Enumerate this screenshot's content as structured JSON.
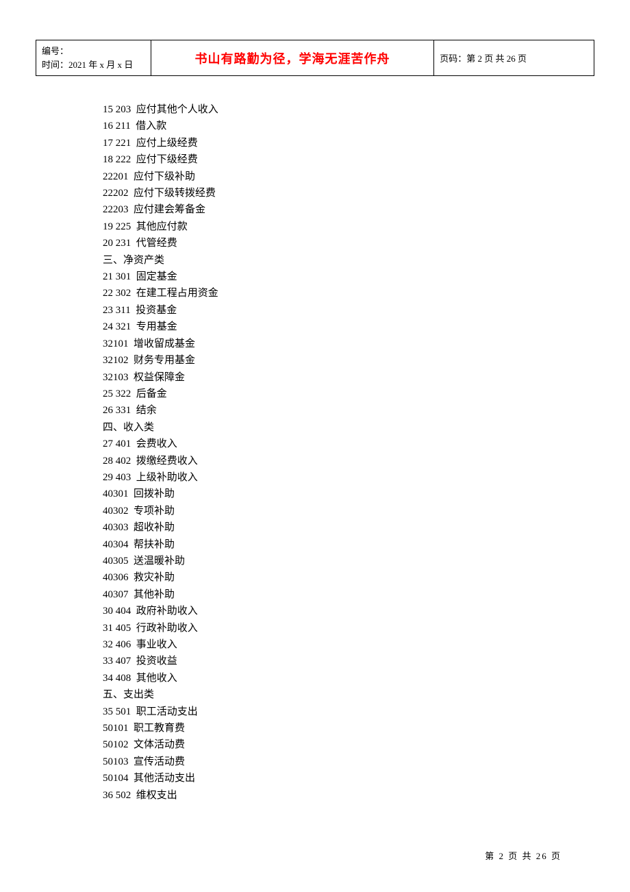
{
  "header": {
    "left_line1": "编号：",
    "left_line2": "时间：2021 年 x 月 x 日",
    "center": "书山有路勤为径，学海无涯苦作舟",
    "right": "页码：第 2 页  共 26 页"
  },
  "lines": [
    "15 203  应付其他个人收入",
    "16 211  借入款",
    "17 221  应付上级经费",
    "18 222  应付下级经费",
    "22201  应付下级补助",
    "22202  应付下级转拨经费",
    "22203  应付建会筹备金",
    "19 225  其他应付款",
    "20 231  代管经费",
    "三、净资产类",
    "21 301  固定基金",
    "22 302  在建工程占用资金",
    "23 311  投资基金",
    "24 321  专用基金",
    "32101  增收留成基金",
    "32102  财务专用基金",
    "32103  权益保障金",
    "25 322  后备金",
    "26 331  结余",
    "四、收入类",
    "27 401  会费收入",
    "28 402  拨缴经费收入",
    "29 403  上级补助收入",
    "40301  回拨补助",
    "40302  专项补助",
    "40303  超收补助",
    "40304  帮扶补助",
    "40305  送温暖补助",
    "40306  救灾补助",
    "40307  其他补助",
    "30 404  政府补助收入",
    "31 405  行政补助收入",
    "32 406  事业收入",
    "33 407  投资收益",
    "34 408  其他收入",
    "五、支出类",
    "35 501  职工活动支出",
    "50101  职工教育费",
    "50102  文体活动费",
    "50103  宣传活动费",
    "50104  其他活动支出",
    "36 502  维权支出"
  ],
  "footer": "第 2 页 共 26 页"
}
